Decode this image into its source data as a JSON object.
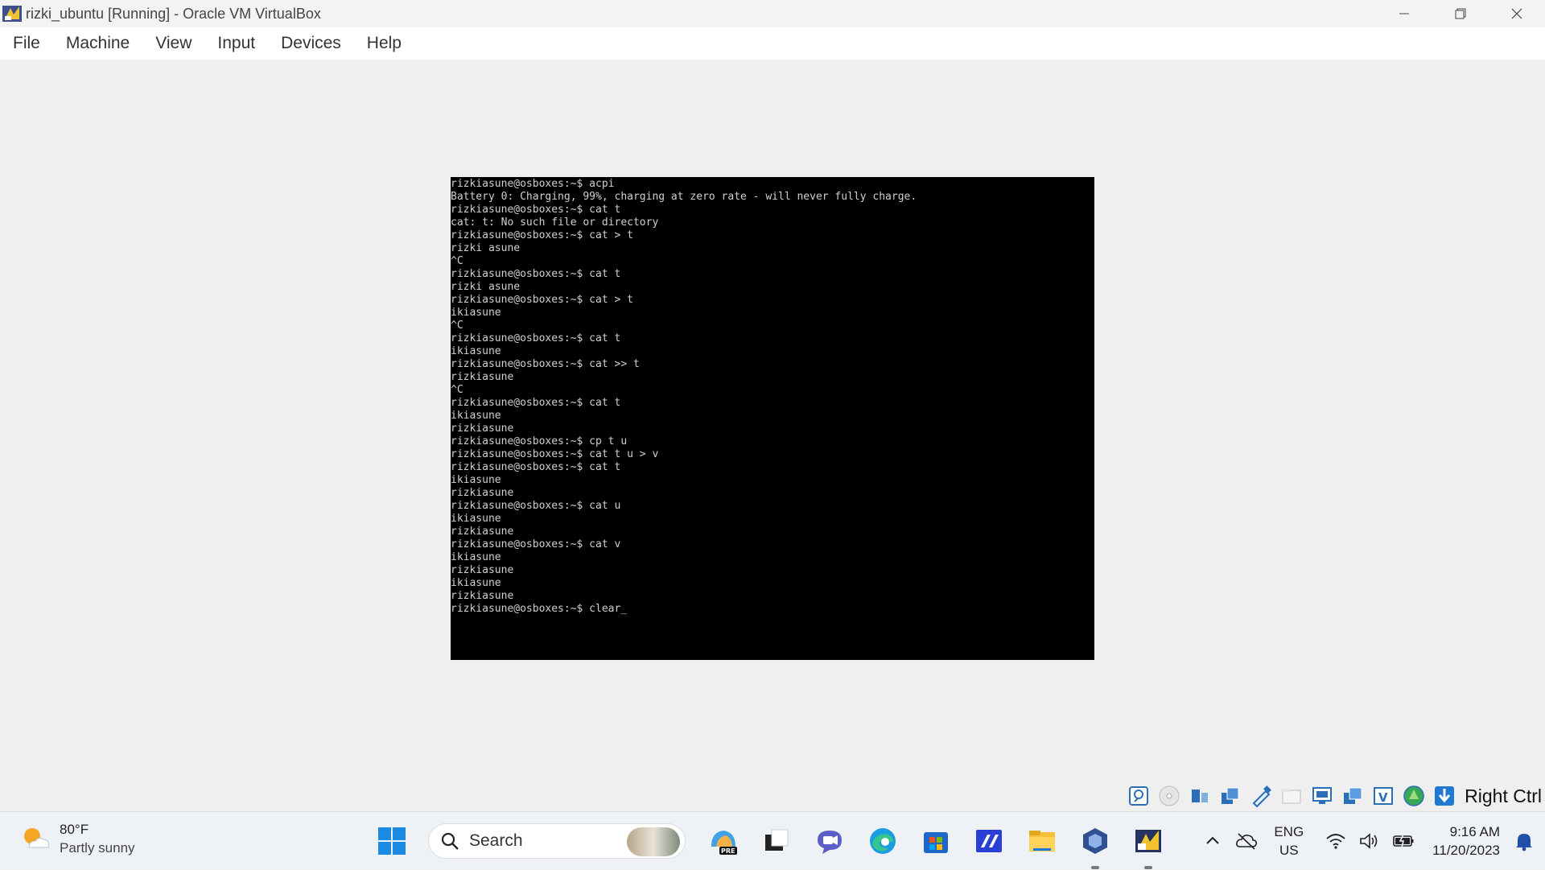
{
  "window": {
    "title": "rizki_ubuntu [Running] - Oracle VM VirtualBox",
    "app_icon": "virtualbox-icon",
    "controls": [
      "minimize-icon",
      "restore-icon",
      "close-icon"
    ]
  },
  "menubar": {
    "items": [
      {
        "label": "File"
      },
      {
        "label": "Machine"
      },
      {
        "label": "View"
      },
      {
        "label": "Input"
      },
      {
        "label": "Devices"
      },
      {
        "label": "Help"
      }
    ]
  },
  "terminal": {
    "lines": [
      "rizkiasune@osboxes:~$ acpi",
      "Battery 0: Charging, 99%, charging at zero rate - will never fully charge.",
      "rizkiasune@osboxes:~$ cat t",
      "cat: t: No such file or directory",
      "rizkiasune@osboxes:~$ cat > t",
      "rizki asune",
      "^C",
      "rizkiasune@osboxes:~$ cat t",
      "rizki asune",
      "rizkiasune@osboxes:~$ cat > t",
      "ikiasune",
      "^C",
      "rizkiasune@osboxes:~$ cat t",
      "ikiasune",
      "rizkiasune@osboxes:~$ cat >> t",
      "rizkiasune",
      "^C",
      "rizkiasune@osboxes:~$ cat t",
      "ikiasune",
      "rizkiasune",
      "rizkiasune@osboxes:~$ cp t u",
      "rizkiasune@osboxes:~$ cat t u > v",
      "rizkiasune@osboxes:~$ cat t",
      "ikiasune",
      "rizkiasune",
      "rizkiasune@osboxes:~$ cat u",
      "ikiasune",
      "rizkiasune",
      "rizkiasune@osboxes:~$ cat v",
      "ikiasune",
      "rizkiasune",
      "ikiasune",
      "rizkiasune",
      "rizkiasune@osboxes:~$ clear_"
    ]
  },
  "statusbar": {
    "icons": [
      "hard-disk-icon",
      "optical-drive-icon",
      "audio-icon",
      "network-icon",
      "usb-icon",
      "shared-folders-icon",
      "display-icon",
      "recording-icon",
      "virtualization-icon",
      "mouse-integration-icon",
      "host-key-arrow-icon"
    ],
    "host_key": "Right Ctrl"
  },
  "taskbar": {
    "weather": {
      "temp": "80°F",
      "desc": "Partly sunny",
      "icon": "partly-sunny-icon"
    },
    "search_label": "Search",
    "apps": [
      "start-icon",
      "copilot-pre-icon",
      "task-view-icon",
      "teams-icon",
      "edge-icon",
      "store-icon",
      "vscode-icon",
      "file-explorer-icon",
      "virtualbox-manager-icon",
      "virtualbox-vm-icon"
    ],
    "tray": {
      "lang_top": "ENG",
      "lang_bottom": "US",
      "time": "9:16 AM",
      "date": "11/20/2023"
    }
  },
  "colors": {
    "terminal_bg": "#000000",
    "terminal_fg": "#cfcfcf",
    "taskbar_bg": "#eef1f6",
    "vm_bg": "#efefef"
  }
}
